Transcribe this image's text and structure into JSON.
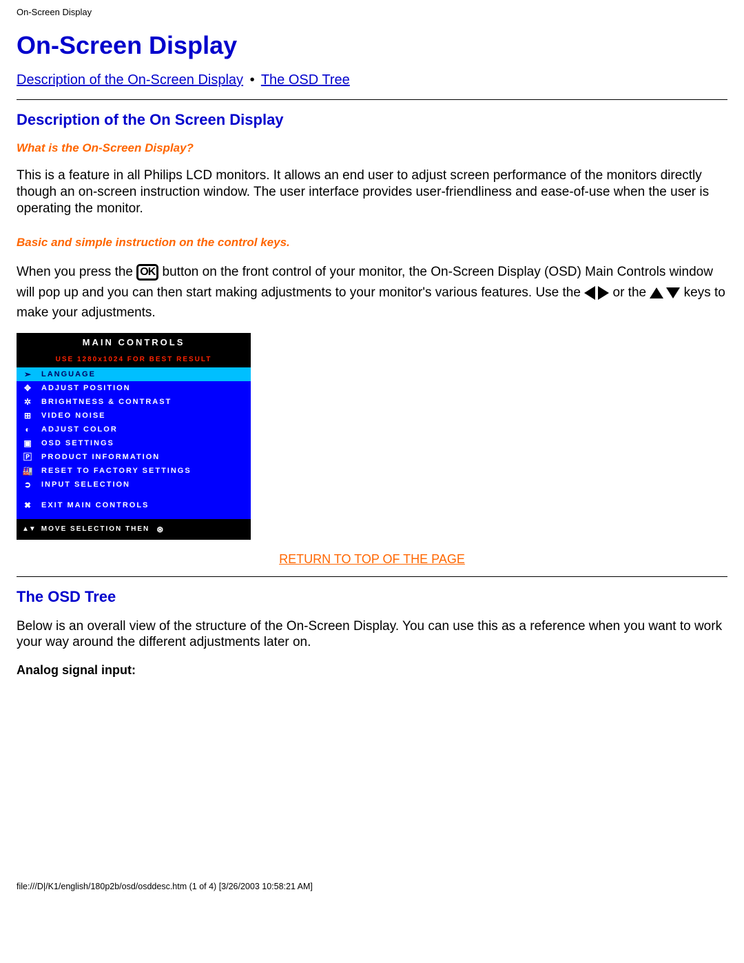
{
  "header": {
    "doc_title": "On-Screen Display"
  },
  "page": {
    "title": "On-Screen Display",
    "nav": {
      "link1": "Description of the On-Screen Display",
      "link2": "The OSD Tree"
    },
    "section1": {
      "heading": "Description of the On Screen Display",
      "q": "What is the On-Screen Display?",
      "p1": "This is a feature in all Philips LCD monitors. It allows an end user to adjust screen performance of the monitors directly though an on-screen instruction window. The user interface provides user-friendliness and ease-of-use when the user is operating the monitor.",
      "sub2": "Basic and simple instruction on the control keys.",
      "p2a": "When you press the ",
      "ok": "OK",
      "p2b": " button on the front control of your monitor, the On-Screen Display (OSD) Main Controls window will pop up and you can then start making adjustments to your monitor's various features. Use the ",
      "p2c": " or the ",
      "p2d": " keys to make your adjustments."
    },
    "osd": {
      "title": "MAIN CONTROLS",
      "warn": "USE 1280x1024 FOR BEST RESULT",
      "items": [
        "LANGUAGE",
        "ADJUST POSITION",
        "BRIGHTNESS & CONTRAST",
        "VIDEO NOISE",
        "ADJUST COLOR",
        "OSD SETTINGS",
        "PRODUCT INFORMATION",
        "RESET TO FACTORY SETTINGS",
        "INPUT SELECTION"
      ],
      "exit": "EXIT MAIN CONTROLS",
      "footer": "MOVE SELECTION THEN"
    },
    "return": "RETURN TO TOP OF THE PAGE",
    "section2": {
      "heading": "The OSD Tree",
      "p": "Below is an overall view of the structure of the On-Screen Display. You can use this as a reference when you want to work your way around the different adjustments later on.",
      "analog": "Analog signal input:"
    }
  },
  "footer": {
    "text": "file:///D|/K1/english/180p2b/osd/osddesc.htm (1 of 4) [3/26/2003 10:58:21 AM]"
  }
}
